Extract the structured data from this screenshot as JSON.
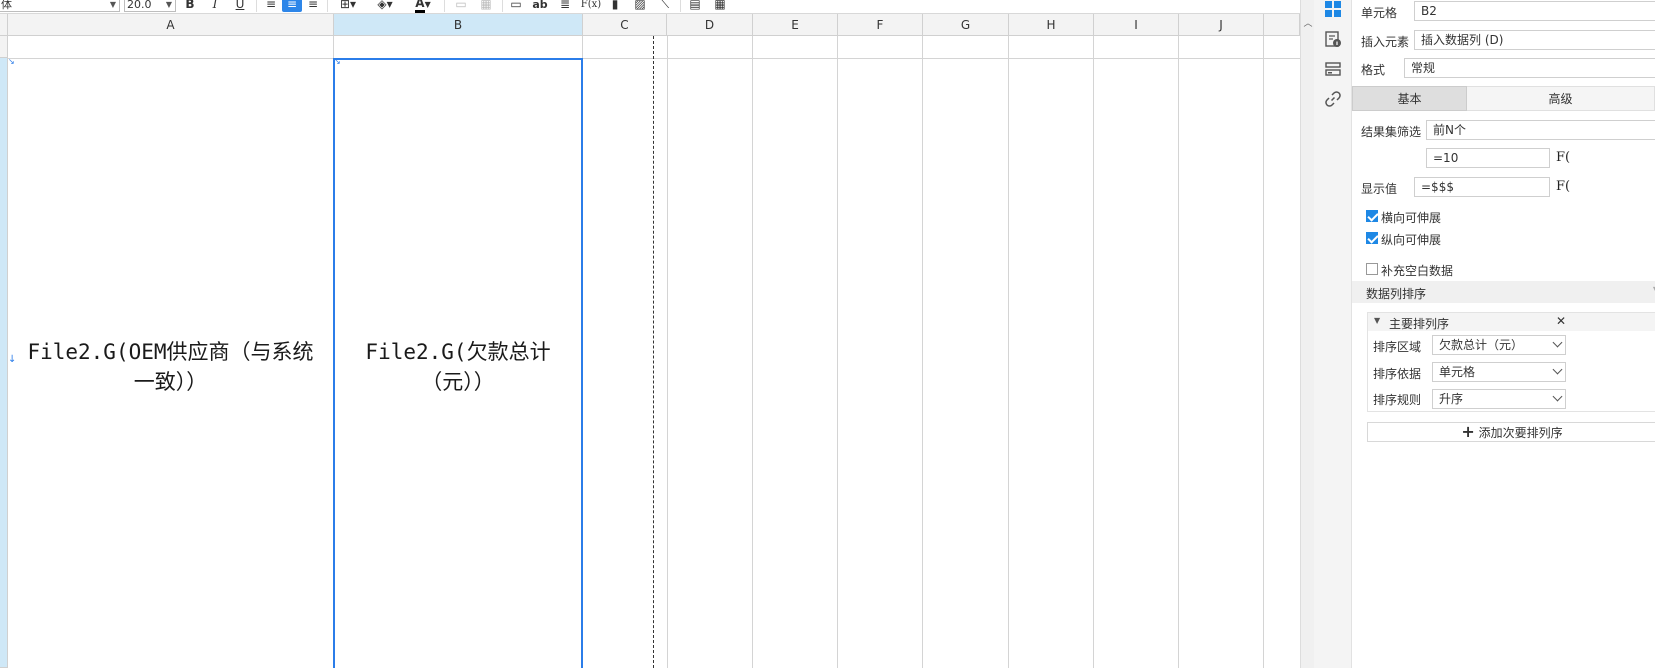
{
  "toolbar": {
    "font_name": "体",
    "font_size": "20.0",
    "bold": "B",
    "italic": "I",
    "underline": "U",
    "text_style_label": "ab",
    "formula_label": "F(x)"
  },
  "sheet": {
    "columns": [
      "A",
      "B",
      "C",
      "D",
      "E",
      "F",
      "G",
      "H",
      "I",
      "J"
    ],
    "selected_column": "B",
    "cells": {
      "A2": "File2.G(OEM供应商（与系统一致））",
      "B2": "File2.G(欠款总计（元））"
    }
  },
  "panel": {
    "cell_label": "单元格",
    "cell_value": "B2",
    "insert_label": "插入元素",
    "insert_value": "插入数据列 (D)",
    "format_label": "格式",
    "format_value": "常规",
    "tabs": [
      "基本",
      "高级"
    ],
    "active_tab": "基本",
    "filter_label": "结果集筛选",
    "filter_value": "前N个",
    "filter_expr": "=10",
    "fx_label": "F(",
    "display_label": "显示值",
    "display_value": "=$$$",
    "checkbox_h": "横向可伸展",
    "checkbox_v": "纵向可伸展",
    "checkbox_fill": "补充空白数据",
    "sort_section": "数据列排序",
    "primary_sort": "主要排列序",
    "sort_area_label": "排序区域",
    "sort_area_value": "欠款总计（元）",
    "sort_basis_label": "排序依据",
    "sort_basis_value": "单元格",
    "sort_rule_label": "排序规则",
    "sort_rule_value": "升序",
    "add_secondary": "添加次要排列序",
    "close_glyph": "✕",
    "plus_glyph": "+"
  }
}
